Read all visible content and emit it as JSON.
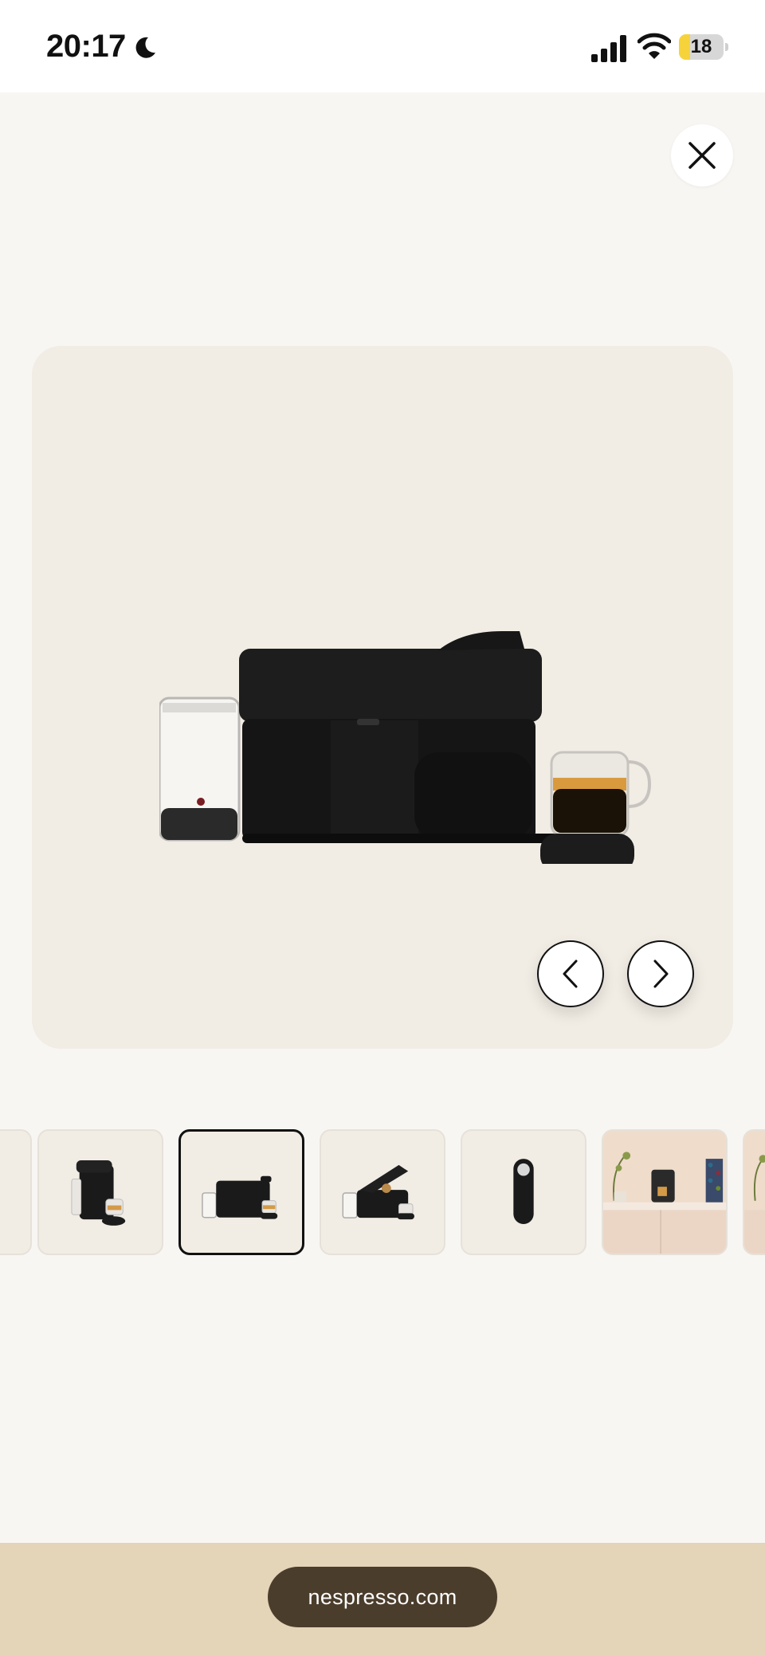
{
  "status_bar": {
    "time": "20:17",
    "battery_level": "18",
    "battery_fraction": 0.18,
    "icons": [
      "moon-icon",
      "signal-icon",
      "wifi-icon",
      "battery-icon"
    ]
  },
  "gallery": {
    "close_icon": "close-icon",
    "prev_icon": "chevron-left-icon",
    "next_icon": "chevron-right-icon",
    "main_image_alt": "black coffee machine with glass cup",
    "thumbnails": [
      {
        "name": "thumbnail-partial-left",
        "selected": false
      },
      {
        "name": "thumbnail-machine-front",
        "selected": false
      },
      {
        "name": "thumbnail-machine-side",
        "selected": true
      },
      {
        "name": "thumbnail-machine-open",
        "selected": false
      },
      {
        "name": "thumbnail-machine-top",
        "selected": false
      },
      {
        "name": "thumbnail-kitchen-scene",
        "selected": false
      },
      {
        "name": "thumbnail-partial-right",
        "selected": false
      }
    ]
  },
  "bottom_bar": {
    "url": "nespresso.com"
  },
  "colors": {
    "page_background": "#f8f6f3",
    "panel_background": "#f1ece4",
    "bottom_bar": "#e4d4b8",
    "url_pill": "#4b3d2c",
    "battery_fill": "#f6d33a"
  }
}
